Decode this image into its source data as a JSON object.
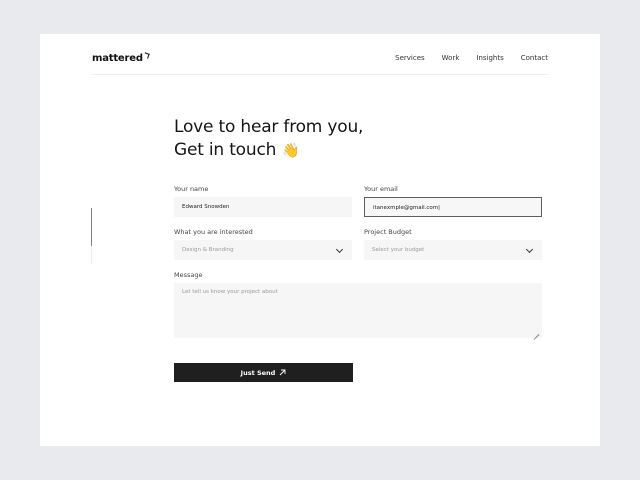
{
  "header": {
    "logo": "mattered",
    "nav": [
      "Services",
      "Work",
      "Insights",
      "Contact"
    ]
  },
  "hero": {
    "line1": "Love to hear from you,",
    "line2": "Get in touch",
    "emoji": "👋"
  },
  "form": {
    "name": {
      "label": "Your name",
      "value": "Edward Snowden"
    },
    "email": {
      "label": "Your email",
      "value": "itanexmple@gmail.com|"
    },
    "interest": {
      "label": "What you are interested",
      "selected": "Design & Branding"
    },
    "budget": {
      "label": "Project Budget",
      "placeholder": "Select your budget"
    },
    "message": {
      "label": "Message",
      "placeholder": "Let tell us know your project about"
    },
    "submit_label": "Just Send"
  },
  "icons": {
    "logo_mark": "logo-tick-icon",
    "dropdown": "chevron-down-icon",
    "submit": "arrow-up-right-icon",
    "resize": "resize-handle-icon"
  },
  "colors": {
    "background": "#e8eaed",
    "card": "#ffffff",
    "button": "#1f1f1f",
    "field": "#f6f6f6"
  }
}
